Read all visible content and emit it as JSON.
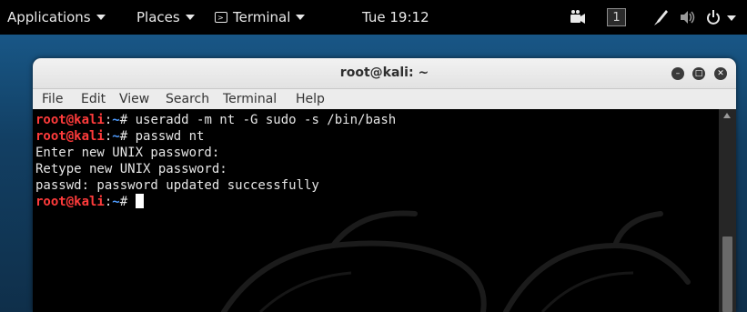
{
  "topbar": {
    "applications_label": "Applications",
    "places_label": "Places",
    "terminal_label": "Terminal",
    "clock": "Tue 19:12",
    "workspace": "1"
  },
  "window": {
    "title": "root@kali: ~",
    "menu": [
      "File",
      "Edit",
      "View",
      "Search",
      "Terminal",
      "Help"
    ]
  },
  "terminal": {
    "prompt_user": "root@kali",
    "prompt_sep": ":",
    "prompt_path": "~",
    "prompt_symbol": "# ",
    "cmd1": "useradd -m nt -G sudo -s /bin/bash",
    "cmd2": "passwd nt",
    "out1": "Enter new UNIX password:",
    "out2": "Retype new UNIX password:",
    "out3": "passwd: password updated successfully"
  },
  "colors": {
    "prompt_user": "#ff3b3b",
    "prompt_path": "#4f9cff",
    "topbar_bg": "#000000",
    "terminal_bg": "#000000"
  }
}
